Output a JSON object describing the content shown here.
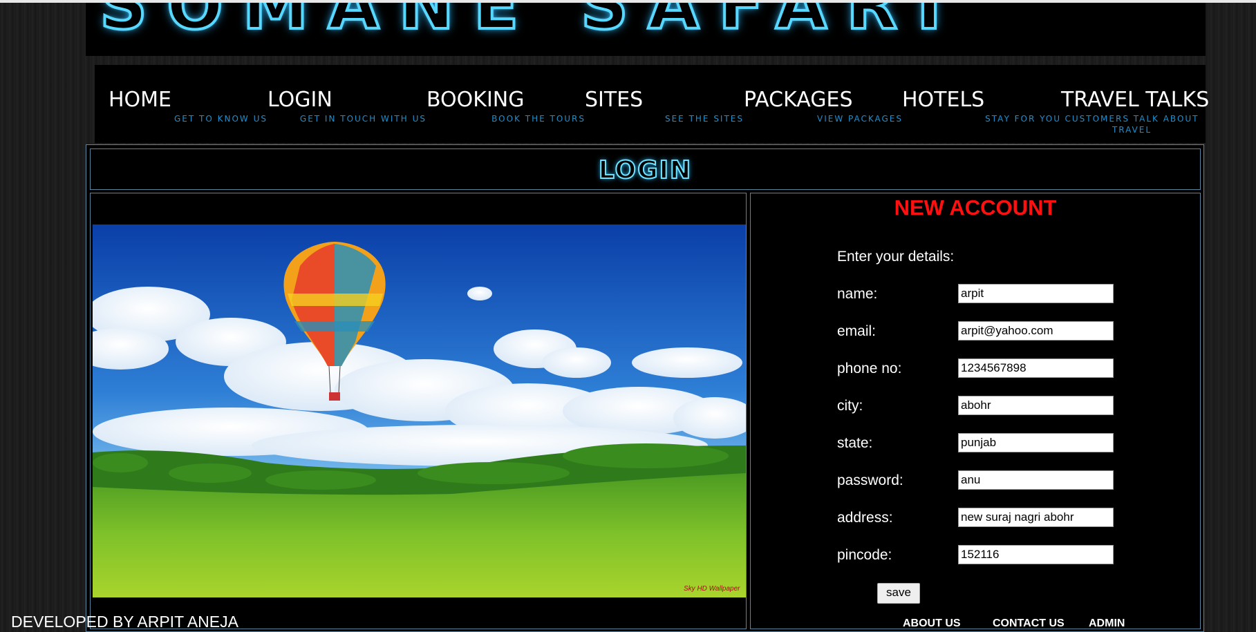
{
  "banner": {
    "title": "SOMANE SAFARI"
  },
  "nav": [
    {
      "title": "HOME",
      "subtitle": "GET TO KNOW US"
    },
    {
      "title": "LOGIN",
      "subtitle": "GET IN TOUCH WITH US"
    },
    {
      "title": "BOOKING",
      "subtitle": "BOOK THE TOURS"
    },
    {
      "title": "SITES",
      "subtitle": "SEE THE SITES"
    },
    {
      "title": "PACKAGES",
      "subtitle": "VIEW PACKAGES"
    },
    {
      "title": "HOTELS",
      "subtitle": "STAY FOR YOU"
    },
    {
      "title": "TRAVEL TALKS",
      "subtitle": "CUSTOMERS TALK ABOUT TRAVEL"
    }
  ],
  "login_header": "LOGIN",
  "image": {
    "watermark": "Sky HD Wallpaper"
  },
  "form": {
    "title": "NEW ACCOUNT",
    "intro": "Enter your details:",
    "fields": [
      {
        "label": "name:",
        "value": "arpit"
      },
      {
        "label": "email:",
        "value": "arpit@yahoo.com"
      },
      {
        "label": "phone no:",
        "value": "1234567898"
      },
      {
        "label": "city:",
        "value": "abohr"
      },
      {
        "label": "state:",
        "value": "punjab"
      },
      {
        "label": "password:",
        "value": "anu"
      },
      {
        "label": "address:",
        "value": "new suraj nagri abohr"
      },
      {
        "label": "pincode:",
        "value": "152116"
      }
    ],
    "save_label": "save"
  },
  "footer_links": {
    "about": "ABOUT US",
    "contact": "CONTACT US",
    "admin": "ADMIN"
  },
  "developer": "DEVELOPED BY ARPIT ANEJA"
}
